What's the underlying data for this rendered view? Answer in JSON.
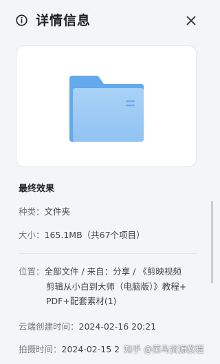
{
  "header": {
    "title": "详情信息",
    "info_icon": "info-circle-icon",
    "close_icon": "close-icon"
  },
  "preview": {
    "icon": "folder-icon",
    "folder_back_color": "#63a9ec",
    "folder_front_color": "#9fcbf5"
  },
  "details": {
    "name": "最终效果",
    "type_label": "种类：",
    "type_value": "文件夹",
    "size_label": "大小：",
    "size_value": "165.1MB（共67个项目）",
    "location_label": "位置：",
    "location_lines": [
      "全部文件 / 来自：分享 / 《剪映视频",
      "剪辑从小白到大师（电脑版）》教程+",
      "PDF+配套素材(1)"
    ],
    "cloud_created_label": "云端创建时间：",
    "cloud_created_value": "2024-02-16 20:21",
    "shot_time_label": "拍摄时间：",
    "shot_time_value": "2024-02-15 2"
  },
  "watermark": {
    "text": "知乎 @菜鸟资源教程"
  }
}
